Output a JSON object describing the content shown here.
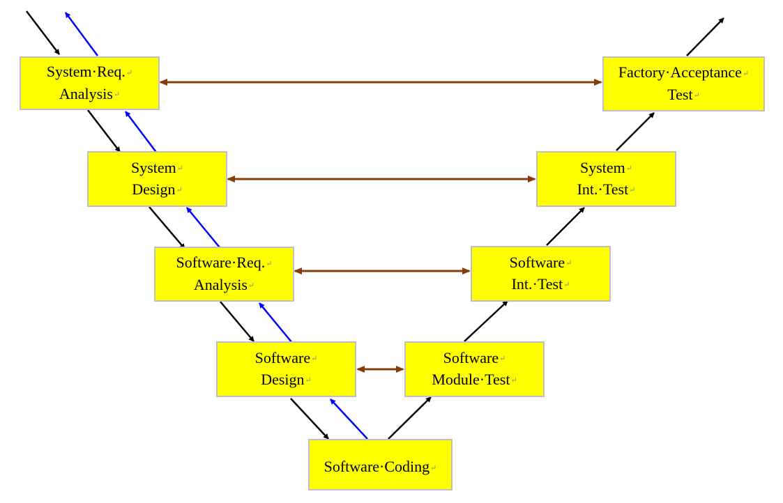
{
  "colors": {
    "box_fill": "#ffff00",
    "box_border": "#bfbfbf",
    "forward_arrow": "#000000",
    "feedback_arrow": "#0000ff",
    "verification_arrow": "#843c0c"
  },
  "boxes": [
    {
      "id": "system-req-analysis",
      "lines": [
        "System·Req.",
        "Analysis"
      ]
    },
    {
      "id": "system-design",
      "lines": [
        "System",
        "Design"
      ]
    },
    {
      "id": "software-req-analysis",
      "lines": [
        "Software·Req.",
        "Analysis"
      ]
    },
    {
      "id": "software-design",
      "lines": [
        "Software",
        "Design"
      ]
    },
    {
      "id": "software-coding",
      "lines": [
        "Software·Coding"
      ]
    },
    {
      "id": "software-module-test",
      "lines": [
        "Software",
        "Module·Test"
      ]
    },
    {
      "id": "software-int-test",
      "lines": [
        "Software",
        "Int.·Test"
      ]
    },
    {
      "id": "system-int-test",
      "lines": [
        "System",
        "Int.·Test"
      ]
    },
    {
      "id": "factory-acceptance-test",
      "lines": [
        "Factory·Acceptance",
        "Test"
      ]
    }
  ]
}
